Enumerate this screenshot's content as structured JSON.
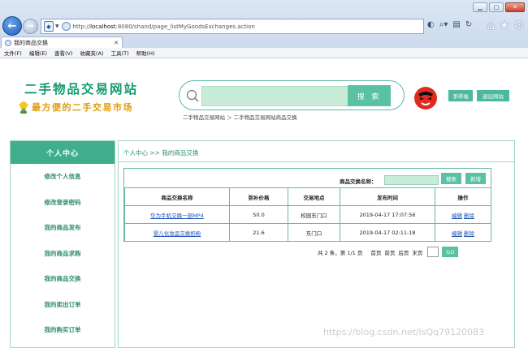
{
  "browser": {
    "url_prefix": "http://",
    "url_host": "localhost",
    "url_rest": ":8080/shand/page_listMyGoodsExchanges.action",
    "tab_title": "我的商品交换",
    "menu": [
      "文件(F)",
      "编辑(E)",
      "查看(V)",
      "收藏夹(A)",
      "工具(T)",
      "帮助(H)"
    ]
  },
  "header": {
    "site_title": "二手物品交易网站",
    "slogan": "最方便的二手交易市场",
    "search_placeholder": "",
    "search_button": "搜 索",
    "breadcrumb": "二手物品交易网站 ＞ 二手物品交易网站商品交换",
    "user_button": "李得福",
    "logout_button": "退出网站"
  },
  "sidebar": {
    "title": "个人中心",
    "items": [
      "修改个人信息",
      "修改登录密码",
      "我的商品发布",
      "我的商品求购",
      "我的商品交换",
      "我的卖出订单",
      "我的购买订单"
    ]
  },
  "main": {
    "breadcrumb": "个人中心 >> 我的商品交换",
    "filter_label": "商品交换名称：",
    "filter_value": "",
    "search_button": "搜索",
    "new_button": "新增",
    "columns": [
      "商品交换名称",
      "弥补价格",
      "交易地点",
      "发布时间",
      "操作"
    ],
    "rows": [
      {
        "name": "华为手机交换一部MP4",
        "price": "50.0",
        "place": "校园东门口",
        "time": "2019-04-17 17:07:56",
        "edit": "编辑",
        "delete": "删除"
      },
      {
        "name": "婴儿化妆品交换奶粉",
        "price": "21.6",
        "place": "东门口",
        "time": "2019-04-17 02:11:18",
        "edit": "编辑",
        "delete": "删除"
      }
    ],
    "pager": {
      "summary": "共 2 条，第 1/1 页",
      "first": "首页",
      "prev": "前页",
      "next": "后页",
      "last": "末页",
      "page_value": "",
      "go": "GO"
    }
  },
  "watermark": "https://blog.csdn.net/lsQq79120083",
  "colors": {
    "accent": "#3fae8c",
    "title": "#129b70",
    "slogan": "#e09c0e",
    "link": "#1b52b8"
  }
}
